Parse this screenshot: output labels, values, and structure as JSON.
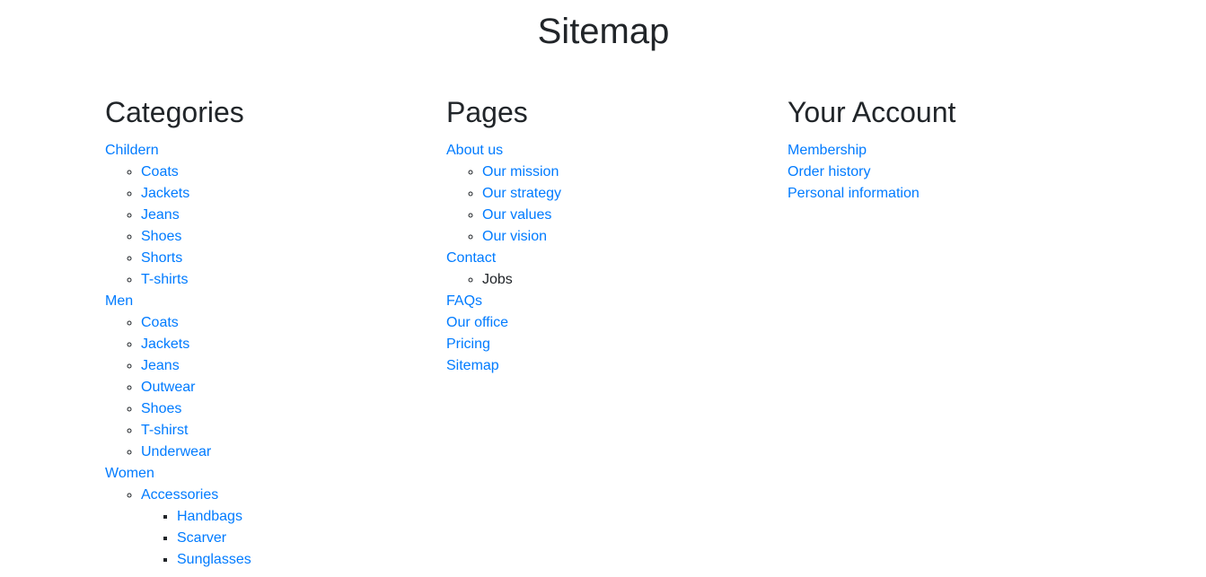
{
  "title": "Sitemap",
  "link_color": "#007bff",
  "columns": {
    "categories": {
      "heading": "Categories",
      "children": {
        "label": "Childern",
        "items": [
          "Coats",
          "Jackets",
          "Jeans",
          "Shoes",
          "Shorts",
          "T-shirts"
        ]
      },
      "men": {
        "label": "Men",
        "items": [
          "Coats",
          "Jackets",
          "Jeans",
          "Outwear",
          "Shoes",
          "T-shirst",
          "Underwear"
        ]
      },
      "women": {
        "label": "Women",
        "accessories": {
          "label": "Accessories",
          "items": [
            "Handbags",
            "Scarver",
            "Sunglasses"
          ]
        }
      }
    },
    "pages": {
      "heading": "Pages",
      "about": {
        "label": "About us",
        "items": [
          "Our mission",
          "Our strategy",
          "Our values",
          "Our vision"
        ]
      },
      "contact": {
        "label": "Contact",
        "items": [
          "Jobs"
        ]
      },
      "others": [
        "FAQs",
        "Our office",
        "Pricing",
        "Sitemap"
      ]
    },
    "account": {
      "heading": "Your Account",
      "items": [
        "Membership",
        "Order history",
        "Personal information"
      ]
    }
  }
}
